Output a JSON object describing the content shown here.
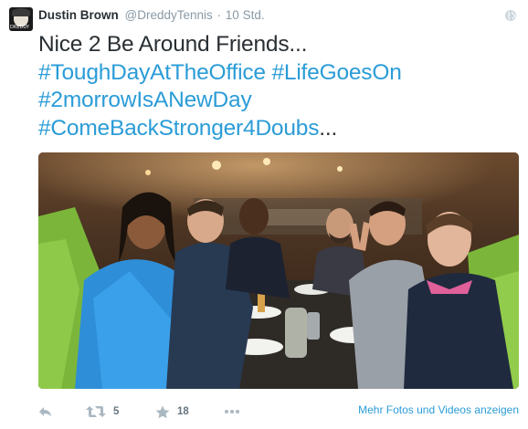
{
  "tweet": {
    "author_name": "Dustin Brown",
    "author_handle": "@DreddyTennis",
    "separator": "·",
    "timestamp": "10 Std.",
    "avatar_text": "DREDDY",
    "text_lines": [
      [
        "Nice 2 Be Around Friends...",
        ""
      ],
      [
        "#ToughDayAtTheOffice #LifeGoesOn",
        ""
      ],
      [
        "#2morrowIsANewDay",
        ""
      ],
      [
        "#ComeBackStronger4Doubs",
        "..."
      ]
    ]
  },
  "footer": {
    "reply_icon": "reply-icon",
    "retweet_icon": "retweet-icon",
    "retweet_count": "5",
    "favorite_icon": "star-icon",
    "favorite_count": "18",
    "more_icon": "more-options-icon",
    "media_link": "Mehr Fotos und Videos anzeigen"
  },
  "colors": {
    "link": "#2b9cd7",
    "text": "#292f33",
    "muted": "#8899a6"
  }
}
